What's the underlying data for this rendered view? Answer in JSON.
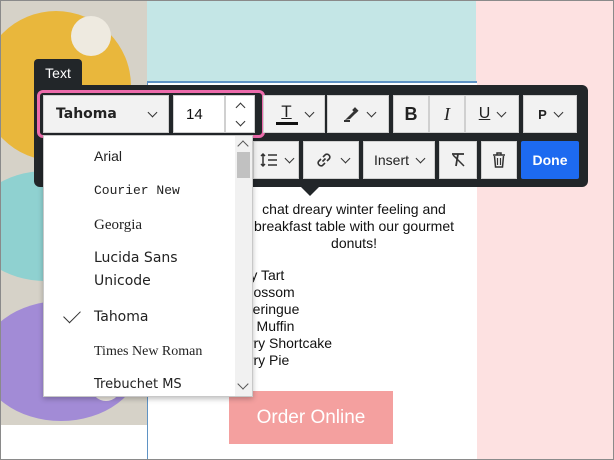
{
  "toolbar": {
    "label": "Text",
    "font_family": "Tahoma",
    "font_size": "14",
    "bold": "B",
    "italic": "I",
    "underline": "U",
    "paragraph": "P",
    "text_color_glyph": "T",
    "insert_label": "Insert",
    "done_label": "Done",
    "done_color": "#1d6af0",
    "highlight_ring_color": "#ec6bab"
  },
  "font_dropdown": {
    "items": [
      {
        "label": "Arial",
        "selected": false
      },
      {
        "label": "Courier New",
        "selected": false
      },
      {
        "label": "Georgia",
        "selected": false
      },
      {
        "label": "Lucida Sans Unicode",
        "selected": false
      },
      {
        "label": "Tahoma",
        "selected": true
      },
      {
        "label": "Times New Roman",
        "selected": false
      },
      {
        "label": "Trebuchet MS",
        "selected": false
      }
    ]
  },
  "email": {
    "body_line1": "chat dreary winter feeling and",
    "body_line2": "breakfast table with our gourmet",
    "body_line3": "donuts!",
    "list": [
      "rry Tart",
      "Blossom",
      "Meringue",
      "ry Muffin",
      "erry Shortcake",
      "erry Pie"
    ],
    "cta_label": "Order Online",
    "cta_color": "#f4a09f"
  },
  "icons": [
    "chevron-down-icon",
    "chevron-up-icon",
    "text-color-icon",
    "highlighter-icon",
    "line-spacing-icon",
    "link-icon",
    "clear-format-icon",
    "trash-icon",
    "checkmark-icon"
  ]
}
